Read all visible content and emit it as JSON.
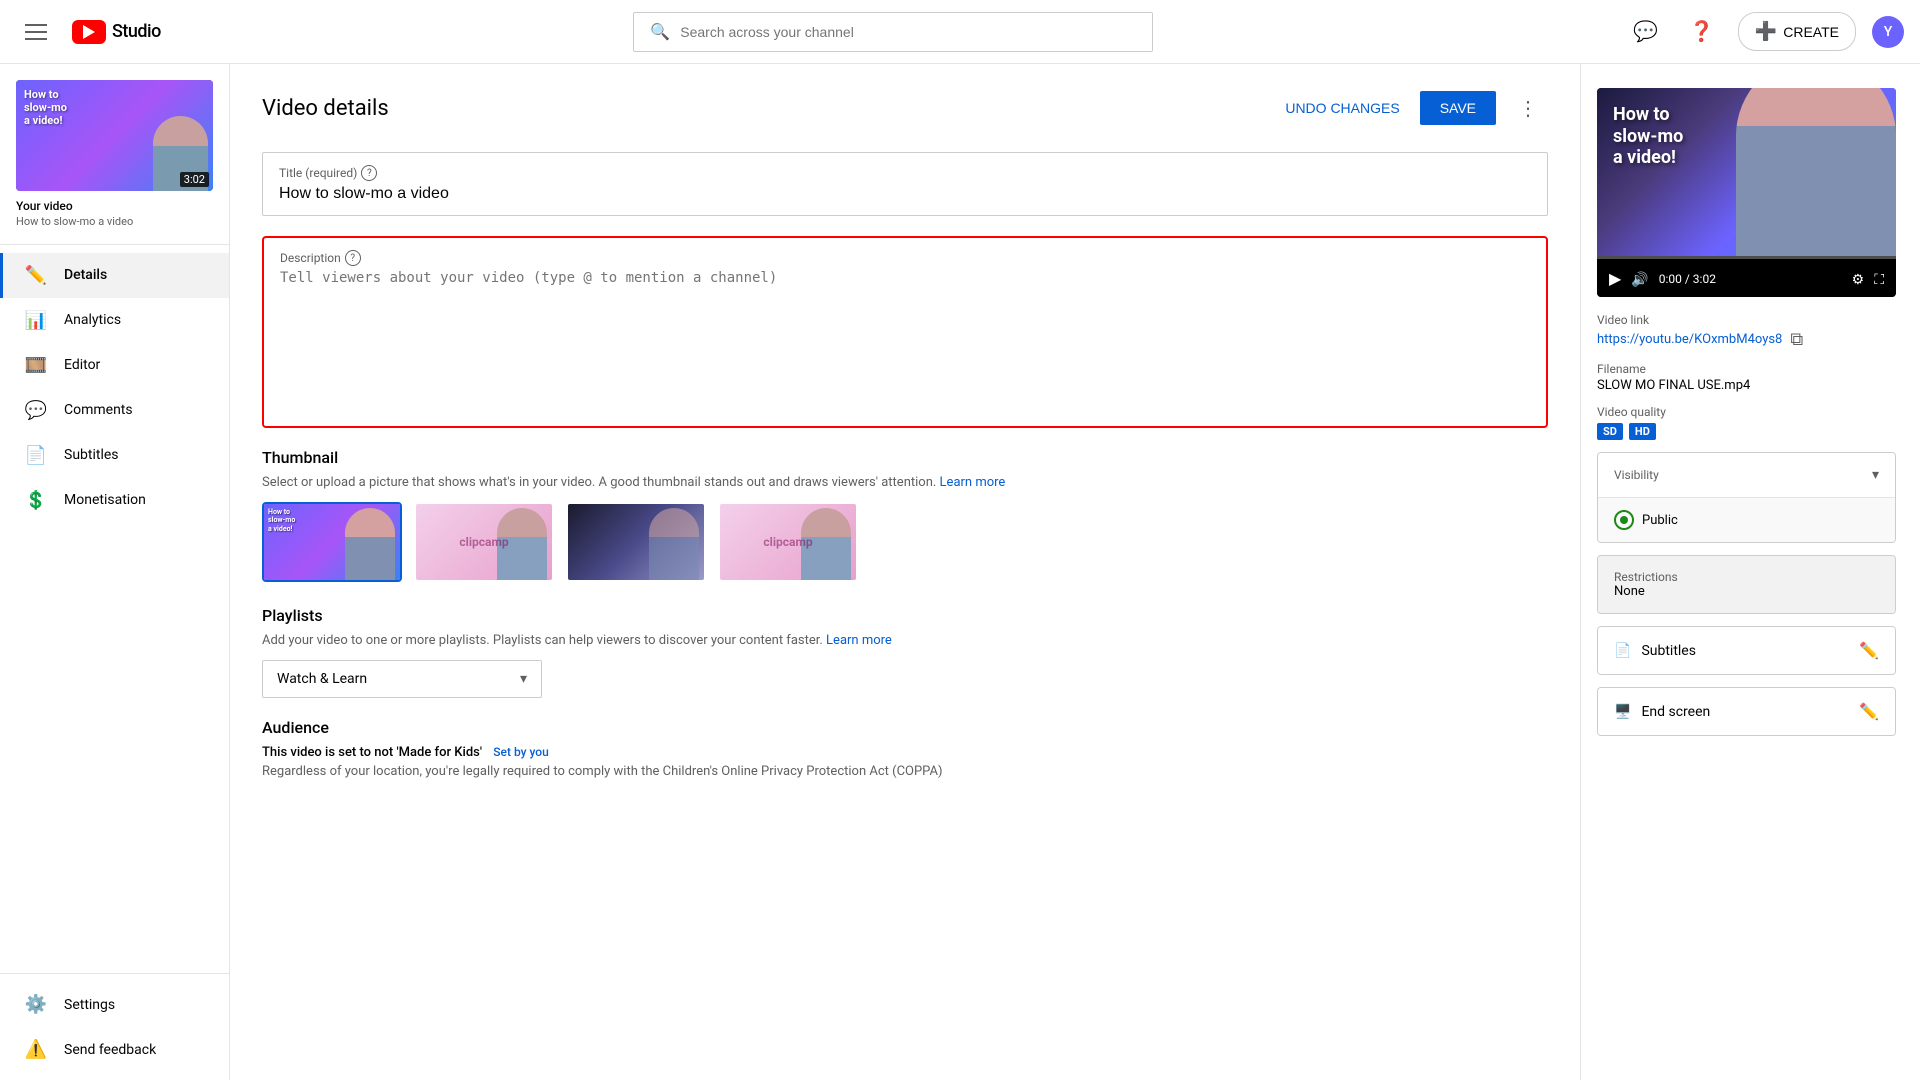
{
  "topNav": {
    "logoText": "Studio",
    "searchPlaceholder": "Search across your channel",
    "createLabel": "CREATE",
    "avatarInitial": "Y"
  },
  "sidebar": {
    "videoTitle": "Your video",
    "videoSubtitle": "How to slow-mo a video",
    "videoDuration": "3:02",
    "navItems": [
      {
        "id": "details",
        "label": "Details",
        "icon": "✏️",
        "active": true
      },
      {
        "id": "analytics",
        "label": "Analytics",
        "icon": "📊",
        "active": false
      },
      {
        "id": "editor",
        "label": "Editor",
        "icon": "🎞️",
        "active": false
      },
      {
        "id": "comments",
        "label": "Comments",
        "icon": "💬",
        "active": false
      },
      {
        "id": "subtitles",
        "label": "Subtitles",
        "icon": "📄",
        "active": false
      },
      {
        "id": "monetisation",
        "label": "Monetisation",
        "icon": "💲",
        "active": false
      }
    ],
    "bottomItems": [
      {
        "id": "settings",
        "label": "Settings",
        "icon": "⚙️"
      },
      {
        "id": "send-feedback",
        "label": "Send feedback",
        "icon": "⚠️"
      }
    ]
  },
  "pageTitle": "Video details",
  "actions": {
    "undoLabel": "UNDO CHANGES",
    "saveLabel": "SAVE"
  },
  "form": {
    "titleLabel": "Title (required)",
    "titleValue": "How to slow-mo a video",
    "descriptionLabel": "Description",
    "descriptionPlaceholder": "Tell viewers about your video (type @ to mention a channel)",
    "thumbnailTitle": "Thumbnail",
    "thumbnailDesc": "Select or upload a picture that shows what's in your video. A good thumbnail stands out and draws viewers' attention.",
    "thumbnailLearnMore": "Learn more",
    "playlistsTitle": "Playlists",
    "playlistsDesc": "Add your video to one or more playlists. Playlists can help viewers to discover your content faster.",
    "playlistsLearnMore": "Learn more",
    "playlistSelected": "Watch & Learn",
    "audienceTitle": "Audience",
    "audienceSubtitle": "This video is set to not 'Made for Kids'",
    "audienceSetBy": "Set by you",
    "audienceDesc": "Regardless of your location, you're legally required to comply with the Children's Online Privacy Protection Act (COPPA)"
  },
  "rightPanel": {
    "videoLinkLabel": "Video link",
    "videoLink": "https://youtu.be/KOxmbM4oys8",
    "filenameLabel": "Filename",
    "filenameValue": "SLOW MO FINAL USE.mp4",
    "videoQualityLabel": "Video quality",
    "qualityBadges": [
      "SD",
      "HD"
    ],
    "timeDisplay": "0:00 / 3:02",
    "visibilityLabel": "Visibility",
    "visibilityValue": "Public",
    "restrictionsLabel": "Restrictions",
    "restrictionsValue": "None",
    "subtitlesLabel": "Subtitles",
    "endScreenLabel": "End screen"
  }
}
